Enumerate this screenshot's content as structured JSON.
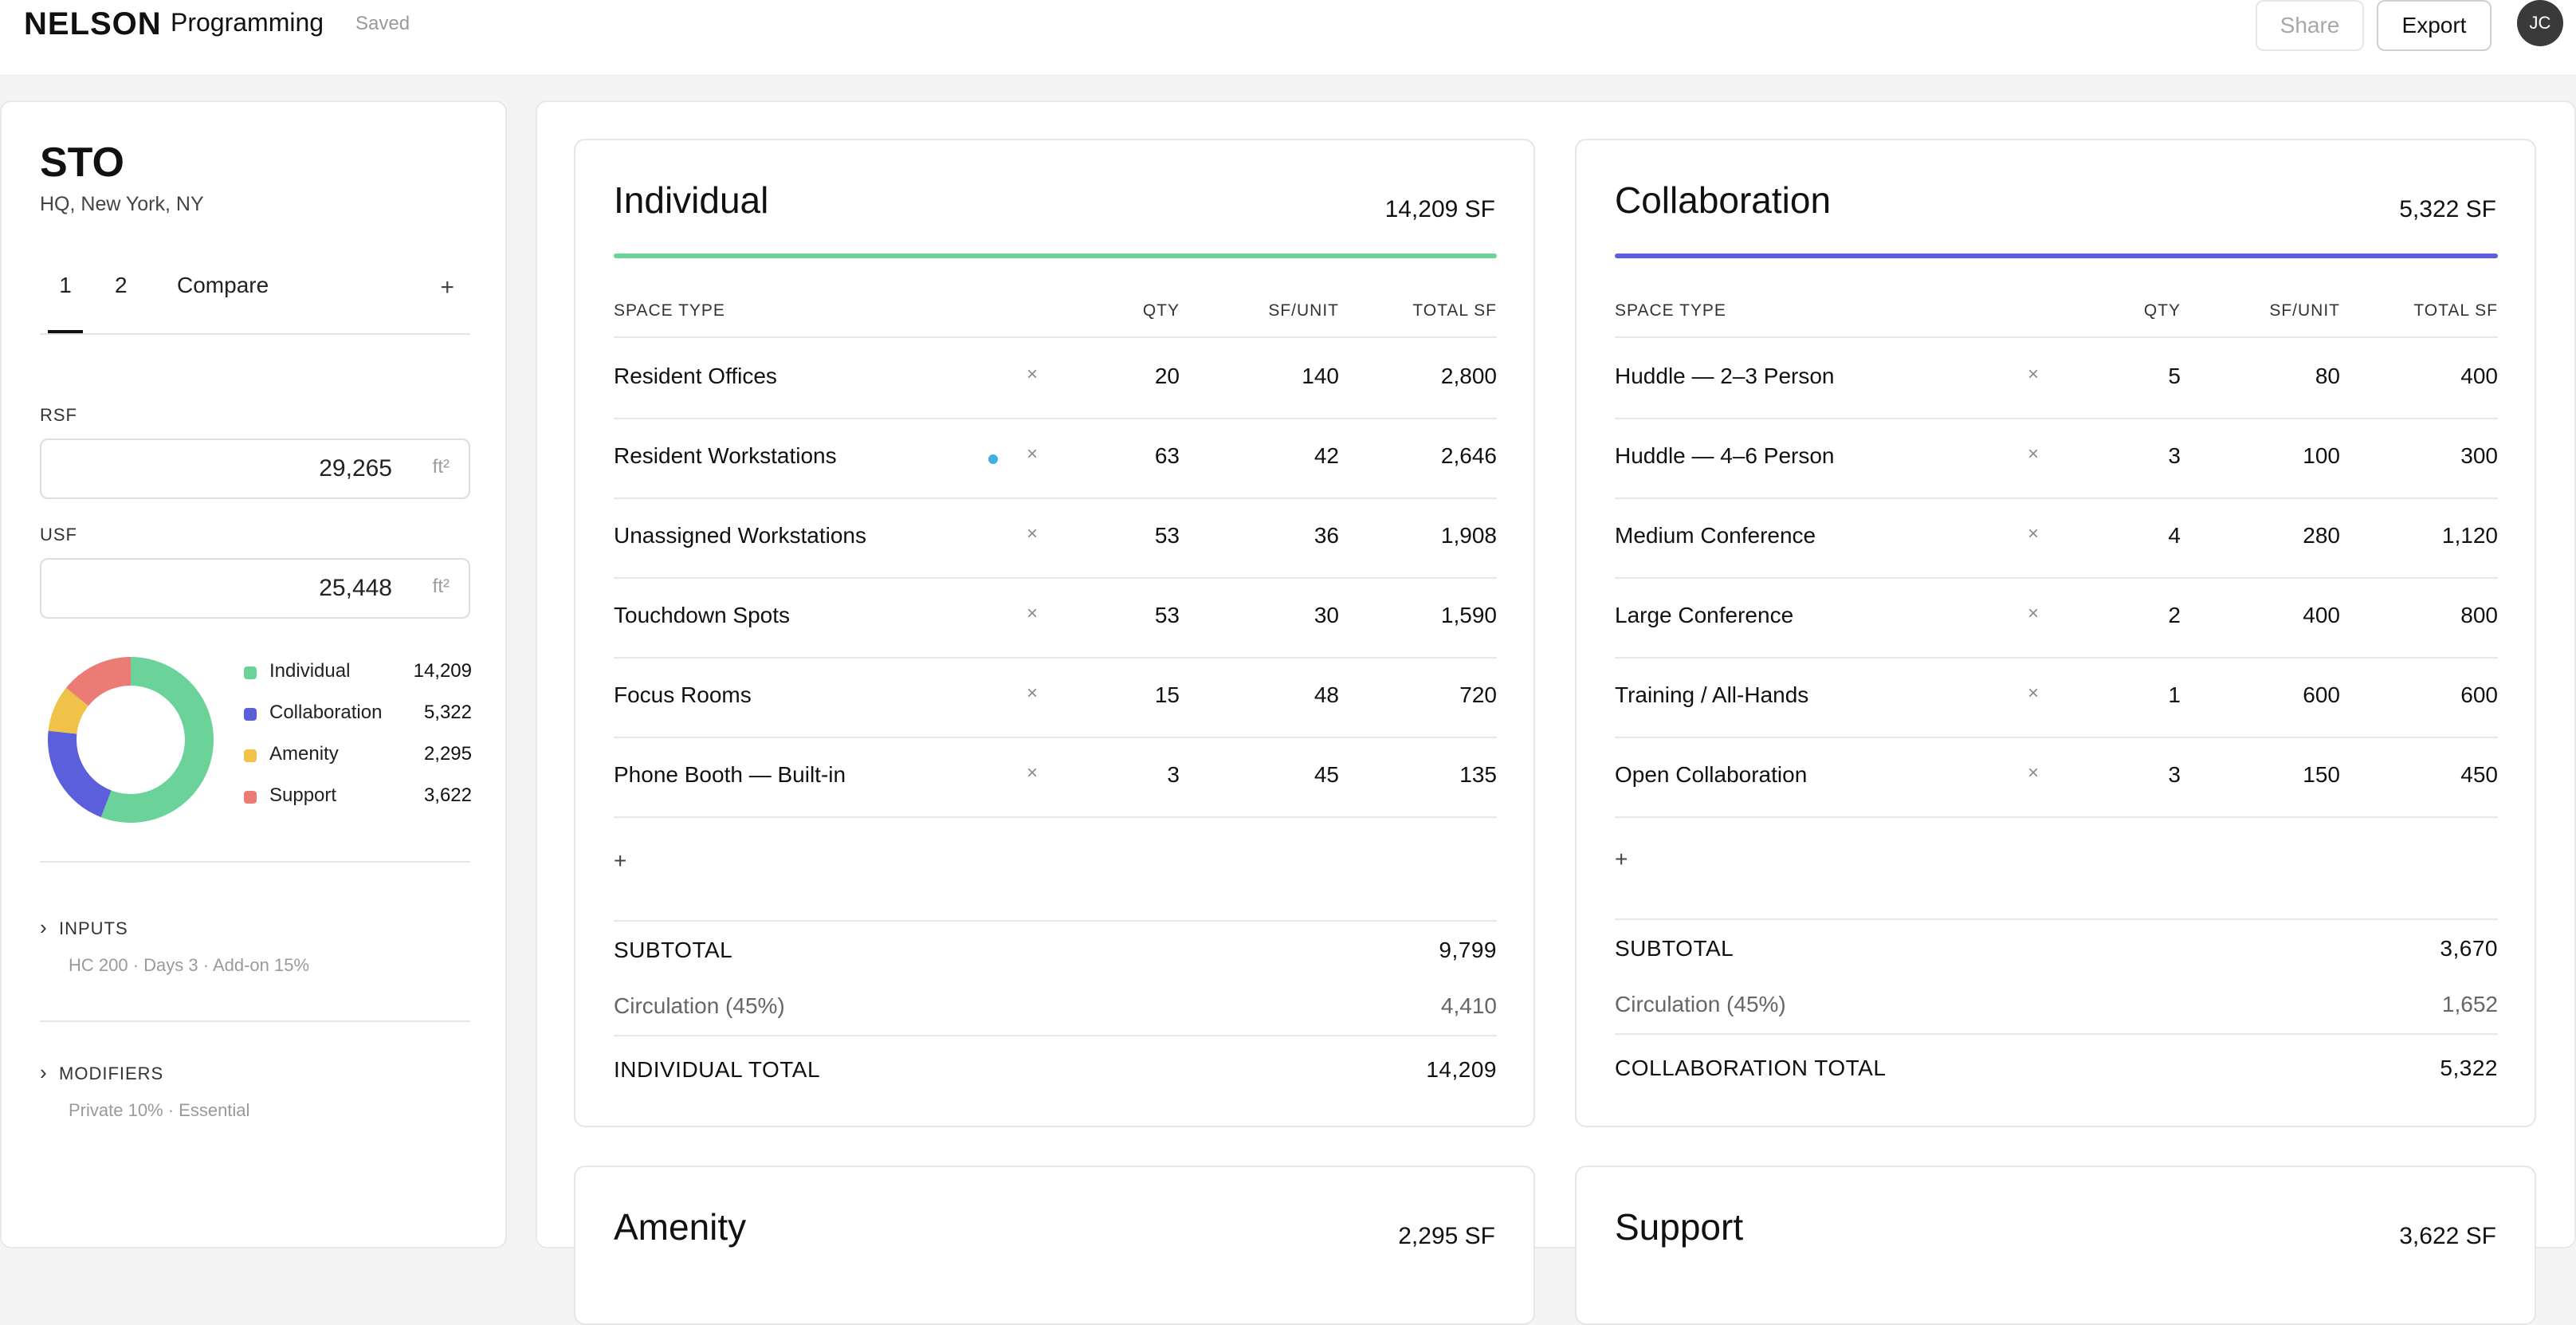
{
  "header": {
    "logo": "NELSON",
    "app_title": "Programming",
    "status": "Saved",
    "share_label": "Share",
    "export_label": "Export",
    "avatar_initials": "JC"
  },
  "sidebar": {
    "project_name": "STO",
    "project_location": "HQ, New York, NY",
    "tabs": [
      "1",
      "2",
      "Compare"
    ],
    "add_tab": "+",
    "rsf_label": "RSF",
    "rsf_value": "29,265",
    "rsf_unit": "ft²",
    "usf_label": "USF",
    "usf_value": "25,448",
    "usf_unit": "ft²",
    "legend": [
      {
        "label": "Individual",
        "value": "14,209",
        "color": "#6bd39a"
      },
      {
        "label": "Collaboration",
        "value": "5,322",
        "color": "#5b5fdc"
      },
      {
        "label": "Amenity",
        "value": "2,295",
        "color": "#f0c24a"
      },
      {
        "label": "Support",
        "value": "3,622",
        "color": "#ea7b75"
      }
    ],
    "donut_values": [
      14209,
      5322,
      2295,
      3622
    ],
    "inputs_label": "INPUTS",
    "inputs_summary": "HC 200 · Days 3 · Add-on 15%",
    "modifiers_label": "MODIFIERS",
    "modifiers_summary": "Private 10% · Essential"
  },
  "table_headers": {
    "space_type": "SPACE TYPE",
    "qty": "QTY",
    "sf_unit": "SF/UNIT",
    "total_sf": "TOTAL SF"
  },
  "remove_glyph": "×",
  "add_glyph": "+",
  "individual": {
    "title": "Individual",
    "total": "14,209 SF",
    "color": "#6bd39a",
    "rows": [
      {
        "name": "Resident Offices",
        "qty": "20",
        "sf_unit": "140",
        "total": "2,800"
      },
      {
        "name": "Resident Workstations",
        "qty": "63",
        "sf_unit": "42",
        "total": "2,646"
      },
      {
        "name": "Unassigned Workstations",
        "qty": "53",
        "sf_unit": "36",
        "total": "1,908"
      },
      {
        "name": "Touchdown Spots",
        "qty": "53",
        "sf_unit": "30",
        "total": "1,590"
      },
      {
        "name": "Focus Rooms",
        "qty": "15",
        "sf_unit": "48",
        "total": "720"
      },
      {
        "name": "Phone Booth — Built-in",
        "qty": "3",
        "sf_unit": "45",
        "total": "135"
      }
    ],
    "subtotal_label": "SUBTOTAL",
    "subtotal": "9,799",
    "circulation_label": "Circulation (45%)",
    "circulation": "4,410",
    "total_label": "INDIVIDUAL TOTAL",
    "grand_total": "14,209"
  },
  "collaboration": {
    "title": "Collaboration",
    "total": "5,322 SF",
    "color": "#5b5fdc",
    "rows": [
      {
        "name": "Huddle — 2–3 Person",
        "qty": "5",
        "sf_unit": "80",
        "total": "400"
      },
      {
        "name": "Huddle — 4–6 Person",
        "qty": "3",
        "sf_unit": "100",
        "total": "300"
      },
      {
        "name": "Medium Conference",
        "qty": "4",
        "sf_unit": "280",
        "total": "1,120"
      },
      {
        "name": "Large Conference",
        "qty": "2",
        "sf_unit": "400",
        "total": "800"
      },
      {
        "name": "Training / All-Hands",
        "qty": "1",
        "sf_unit": "600",
        "total": "600"
      },
      {
        "name": "Open Collaboration",
        "qty": "3",
        "sf_unit": "150",
        "total": "450"
      }
    ],
    "subtotal_label": "SUBTOTAL",
    "subtotal": "3,670",
    "circulation_label": "Circulation (45%)",
    "circulation": "1,652",
    "total_label": "COLLABORATION TOTAL",
    "grand_total": "5,322"
  },
  "amenity": {
    "title": "Amenity",
    "total": "2,295 SF"
  },
  "support": {
    "title": "Support",
    "total": "3,622 SF"
  }
}
